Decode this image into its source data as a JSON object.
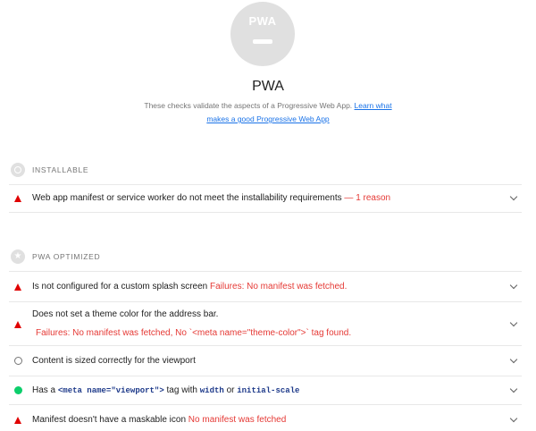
{
  "header": {
    "gauge_label": "PWA",
    "title": "PWA",
    "description": "These checks validate the aspects of a Progressive Web App.",
    "link_text": "Learn what makes a good Progressive Web App"
  },
  "groups": [
    {
      "title": "INSTALLABLE",
      "audits": [
        {
          "status": "fail",
          "text": "Web app manifest or service worker do not meet the installability requirements",
          "detail": "— 1 reason"
        }
      ]
    },
    {
      "title": "PWA OPTIMIZED",
      "audits": [
        {
          "status": "fail",
          "text": "Is not configured for a custom splash screen",
          "detail": "Failures: No manifest was fetched."
        },
        {
          "status": "fail",
          "text": "Does not set a theme color for the address bar.",
          "detail": "Failures: No manifest was fetched, No `<meta name=\"theme-color\">` tag found."
        },
        {
          "status": "manual",
          "text": "Content is sized correctly for the viewport"
        },
        {
          "status": "pass",
          "text_before": "Has a",
          "code1": "<meta name=\"viewport\">",
          "text_mid": "tag with",
          "code2": "width",
          "text_or": "or",
          "code3": "initial-scale"
        },
        {
          "status": "fail",
          "text": "Manifest doesn't have a maskable icon",
          "detail": "No manifest was fetched"
        }
      ]
    }
  ],
  "colors": {
    "fail": "#e53935",
    "pass": "#0cce6b",
    "link": "#1a73e8"
  }
}
